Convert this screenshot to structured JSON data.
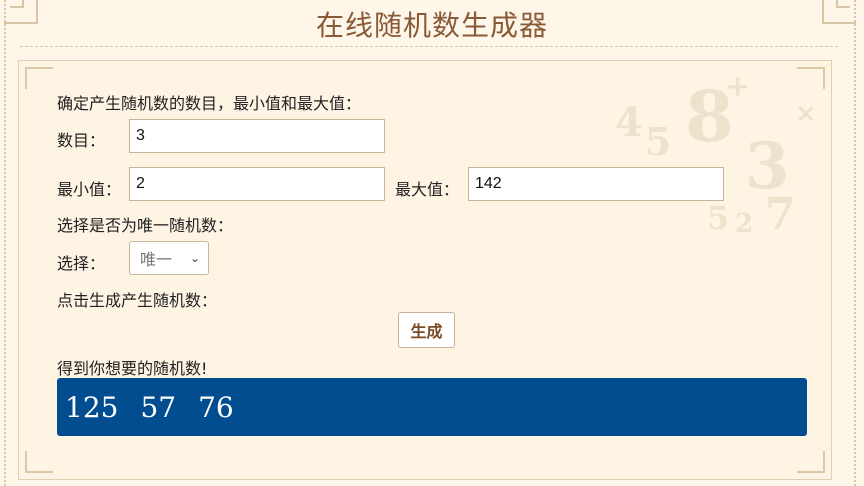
{
  "header": {
    "title": "在线随机数生成器"
  },
  "form": {
    "intro": "确定产生随机数的数目，最小值和最大值：",
    "count_label": "数目：",
    "count_value": "3",
    "min_label": "最小值：",
    "min_value": "2",
    "max_label": "最大值：",
    "max_value": "142",
    "unique_prompt": "选择是否为唯一随机数：",
    "select_label": "选择：",
    "select_value": "唯一",
    "click_prompt": "点击生成产生随机数：",
    "generate_label": "生成"
  },
  "result": {
    "heading": "得到你想要的随机数!",
    "values": [
      "125",
      "57",
      "76"
    ]
  },
  "colors": {
    "result_background": "#024d8f",
    "title_color": "#8a5a36",
    "page_background": "#fdf6e9"
  }
}
